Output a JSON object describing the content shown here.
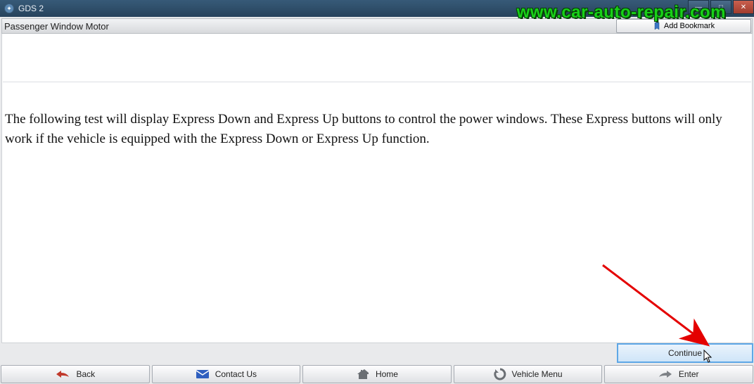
{
  "window": {
    "title": "GDS 2",
    "watermark": "www.car-auto-repair.com"
  },
  "header": {
    "page_title": "Passenger Window Motor",
    "bookmark_label": "Add Bookmark"
  },
  "content": {
    "body_text": "The following test will display Express Down and Express Up buttons to control the power windows. These Express buttons will only work if the vehicle is equipped with the Express Down or Express Up function."
  },
  "action_row": {
    "continue_label": "Continue"
  },
  "toolbar": {
    "back": "Back",
    "contact": "Contact Us",
    "home": "Home",
    "vehicle_menu": "Vehicle Menu",
    "enter": "Enter"
  }
}
